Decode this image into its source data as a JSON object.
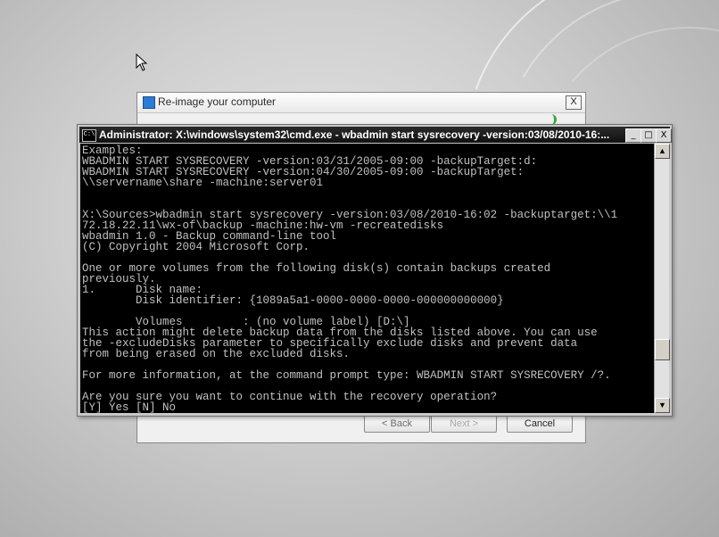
{
  "reimage_dialog": {
    "title": "Re-image your computer",
    "close_label": "X",
    "back_label": "< Back",
    "next_label": "Next >",
    "cancel_label": "Cancel"
  },
  "cmd_window": {
    "title": "Administrator: X:\\windows\\system32\\cmd.exe - wbadmin  start sysrecovery -version:03/08/2010-16:...",
    "icon_label": "C:\\",
    "min_label": "_",
    "max_label": "□",
    "close_label": "X",
    "console_text": "Examples:\nWBADMIN START SYSRECOVERY -version:03/31/2005-09:00 -backupTarget:d:\nWBADMIN START SYSRECOVERY -version:04/30/2005-09:00 -backupTarget:\n\\\\servername\\share -machine:server01\n\n\nX:\\Sources>wbadmin start sysrecovery -version:03/08/2010-16:02 -backuptarget:\\\\1\n72.18.22.11\\wx-of\\backup -machine:hw-vm -recreatedisks\nwbadmin 1.0 - Backup command-line tool\n(C) Copyright 2004 Microsoft Corp.\n\nOne or more volumes from the following disk(s) contain backups created\npreviously.\n1.      Disk name:\n        Disk identifier: {1089a5a1-0000-0000-0000-000000000000}\n\n        Volumes         : (no volume label) [D:\\]\nThis action might delete backup data from the disks listed above. You can use\nthe -excludeDisks parameter to specifically exclude disks and prevent data\nfrom being erased on the excluded disks.\n\nFor more information, at the command prompt type: WBADMIN START SYSRECOVERY /?.\n\nAre you sure you want to continue with the recovery operation?\n[Y] Yes [N] No",
    "scroll_position": 0.82
  }
}
